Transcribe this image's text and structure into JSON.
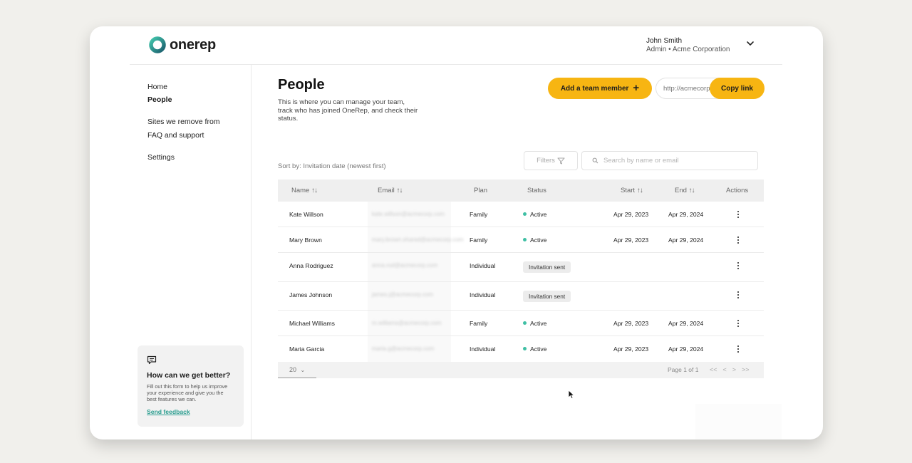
{
  "brand": {
    "name": "onerep",
    "accent": "#f7b512",
    "teal": "#2a9d8f"
  },
  "user": {
    "name": "John Smith",
    "role": "Admin • Acme Corporation"
  },
  "sidebar": {
    "items": [
      {
        "label": "Home",
        "active": false
      },
      {
        "label": "People",
        "active": true
      },
      {
        "label": "Sites we remove from",
        "active": false
      },
      {
        "label": "FAQ and support",
        "active": false
      },
      {
        "label": "Settings",
        "active": false
      }
    ],
    "feedback": {
      "title": "How can we get better?",
      "text": "Fill out this form to help us improve your experience and give you the best features we can.",
      "link": "Send feedback"
    }
  },
  "page": {
    "title": "People",
    "description": "This is where you can manage your team, track who has joined OneRep, and check their status.",
    "add_button": "Add a team member",
    "invite_link_placeholder": "http://acmecorp",
    "copy_button": "Copy link",
    "sort_label": "Sort by: Invitation date (newest first)",
    "filters_label": "Filters",
    "search_placeholder": "Search by name or email"
  },
  "table": {
    "columns": {
      "name": "Name",
      "email": "Email",
      "plan": "Plan",
      "status": "Status",
      "start": "Start",
      "end": "End",
      "actions": "Actions"
    },
    "rows": [
      {
        "name": "Kate Willson",
        "plan": "Family",
        "status": "Active",
        "start": "Apr 29, 2023",
        "end": "Apr 29, 2024"
      },
      {
        "name": "Mary Brown",
        "plan": "Family",
        "status": "Active",
        "start": "Apr 29, 2023",
        "end": "Apr 29, 2024"
      },
      {
        "name": "Anna Rodriguez",
        "plan": "Individual",
        "status": "Invitation sent",
        "start": "",
        "end": ""
      },
      {
        "name": "James Johnson",
        "plan": "Individual",
        "status": "Invitation sent",
        "start": "",
        "end": ""
      },
      {
        "name": "Michael Williams",
        "plan": "Family",
        "status": "Active",
        "start": "Apr 29, 2023",
        "end": "Apr 29, 2024"
      },
      {
        "name": "Maria Garcia",
        "plan": "Individual",
        "status": "Active",
        "start": "Apr 29, 2023",
        "end": "Apr 29, 2024"
      }
    ],
    "footer": {
      "page_size": "20",
      "page_info": "Page 1 of 1",
      "pager": [
        "<<",
        "<",
        ">",
        ">>"
      ]
    }
  }
}
